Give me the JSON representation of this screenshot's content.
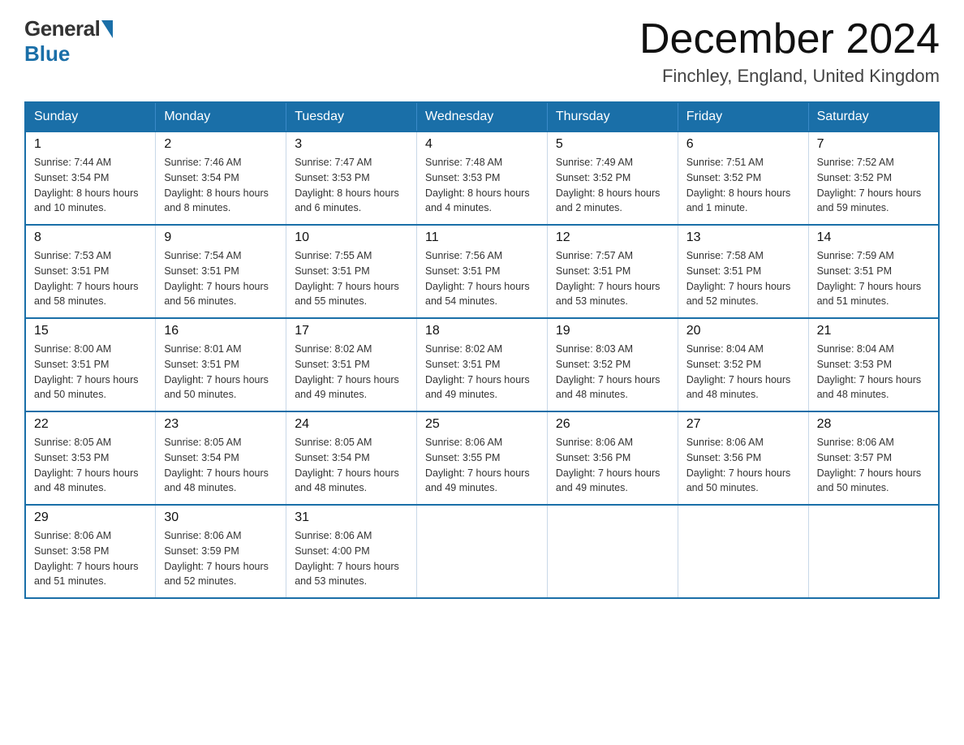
{
  "header": {
    "logo_general": "General",
    "logo_blue": "Blue",
    "title": "December 2024",
    "location": "Finchley, England, United Kingdom"
  },
  "calendar": {
    "days_of_week": [
      "Sunday",
      "Monday",
      "Tuesday",
      "Wednesday",
      "Thursday",
      "Friday",
      "Saturday"
    ],
    "weeks": [
      [
        {
          "day": "1",
          "sunrise": "7:44 AM",
          "sunset": "3:54 PM",
          "daylight": "8 hours and 10 minutes."
        },
        {
          "day": "2",
          "sunrise": "7:46 AM",
          "sunset": "3:54 PM",
          "daylight": "8 hours and 8 minutes."
        },
        {
          "day": "3",
          "sunrise": "7:47 AM",
          "sunset": "3:53 PM",
          "daylight": "8 hours and 6 minutes."
        },
        {
          "day": "4",
          "sunrise": "7:48 AM",
          "sunset": "3:53 PM",
          "daylight": "8 hours and 4 minutes."
        },
        {
          "day": "5",
          "sunrise": "7:49 AM",
          "sunset": "3:52 PM",
          "daylight": "8 hours and 2 minutes."
        },
        {
          "day": "6",
          "sunrise": "7:51 AM",
          "sunset": "3:52 PM",
          "daylight": "8 hours and 1 minute."
        },
        {
          "day": "7",
          "sunrise": "7:52 AM",
          "sunset": "3:52 PM",
          "daylight": "7 hours and 59 minutes."
        }
      ],
      [
        {
          "day": "8",
          "sunrise": "7:53 AM",
          "sunset": "3:51 PM",
          "daylight": "7 hours and 58 minutes."
        },
        {
          "day": "9",
          "sunrise": "7:54 AM",
          "sunset": "3:51 PM",
          "daylight": "7 hours and 56 minutes."
        },
        {
          "day": "10",
          "sunrise": "7:55 AM",
          "sunset": "3:51 PM",
          "daylight": "7 hours and 55 minutes."
        },
        {
          "day": "11",
          "sunrise": "7:56 AM",
          "sunset": "3:51 PM",
          "daylight": "7 hours and 54 minutes."
        },
        {
          "day": "12",
          "sunrise": "7:57 AM",
          "sunset": "3:51 PM",
          "daylight": "7 hours and 53 minutes."
        },
        {
          "day": "13",
          "sunrise": "7:58 AM",
          "sunset": "3:51 PM",
          "daylight": "7 hours and 52 minutes."
        },
        {
          "day": "14",
          "sunrise": "7:59 AM",
          "sunset": "3:51 PM",
          "daylight": "7 hours and 51 minutes."
        }
      ],
      [
        {
          "day": "15",
          "sunrise": "8:00 AM",
          "sunset": "3:51 PM",
          "daylight": "7 hours and 50 minutes."
        },
        {
          "day": "16",
          "sunrise": "8:01 AM",
          "sunset": "3:51 PM",
          "daylight": "7 hours and 50 minutes."
        },
        {
          "day": "17",
          "sunrise": "8:02 AM",
          "sunset": "3:51 PM",
          "daylight": "7 hours and 49 minutes."
        },
        {
          "day": "18",
          "sunrise": "8:02 AM",
          "sunset": "3:51 PM",
          "daylight": "7 hours and 49 minutes."
        },
        {
          "day": "19",
          "sunrise": "8:03 AM",
          "sunset": "3:52 PM",
          "daylight": "7 hours and 48 minutes."
        },
        {
          "day": "20",
          "sunrise": "8:04 AM",
          "sunset": "3:52 PM",
          "daylight": "7 hours and 48 minutes."
        },
        {
          "day": "21",
          "sunrise": "8:04 AM",
          "sunset": "3:53 PM",
          "daylight": "7 hours and 48 minutes."
        }
      ],
      [
        {
          "day": "22",
          "sunrise": "8:05 AM",
          "sunset": "3:53 PM",
          "daylight": "7 hours and 48 minutes."
        },
        {
          "day": "23",
          "sunrise": "8:05 AM",
          "sunset": "3:54 PM",
          "daylight": "7 hours and 48 minutes."
        },
        {
          "day": "24",
          "sunrise": "8:05 AM",
          "sunset": "3:54 PM",
          "daylight": "7 hours and 48 minutes."
        },
        {
          "day": "25",
          "sunrise": "8:06 AM",
          "sunset": "3:55 PM",
          "daylight": "7 hours and 49 minutes."
        },
        {
          "day": "26",
          "sunrise": "8:06 AM",
          "sunset": "3:56 PM",
          "daylight": "7 hours and 49 minutes."
        },
        {
          "day": "27",
          "sunrise": "8:06 AM",
          "sunset": "3:56 PM",
          "daylight": "7 hours and 50 minutes."
        },
        {
          "day": "28",
          "sunrise": "8:06 AM",
          "sunset": "3:57 PM",
          "daylight": "7 hours and 50 minutes."
        }
      ],
      [
        {
          "day": "29",
          "sunrise": "8:06 AM",
          "sunset": "3:58 PM",
          "daylight": "7 hours and 51 minutes."
        },
        {
          "day": "30",
          "sunrise": "8:06 AM",
          "sunset": "3:59 PM",
          "daylight": "7 hours and 52 minutes."
        },
        {
          "day": "31",
          "sunrise": "8:06 AM",
          "sunset": "4:00 PM",
          "daylight": "7 hours and 53 minutes."
        },
        null,
        null,
        null,
        null
      ]
    ],
    "labels": {
      "sunrise": "Sunrise:",
      "sunset": "Sunset:",
      "daylight": "Daylight:"
    }
  }
}
